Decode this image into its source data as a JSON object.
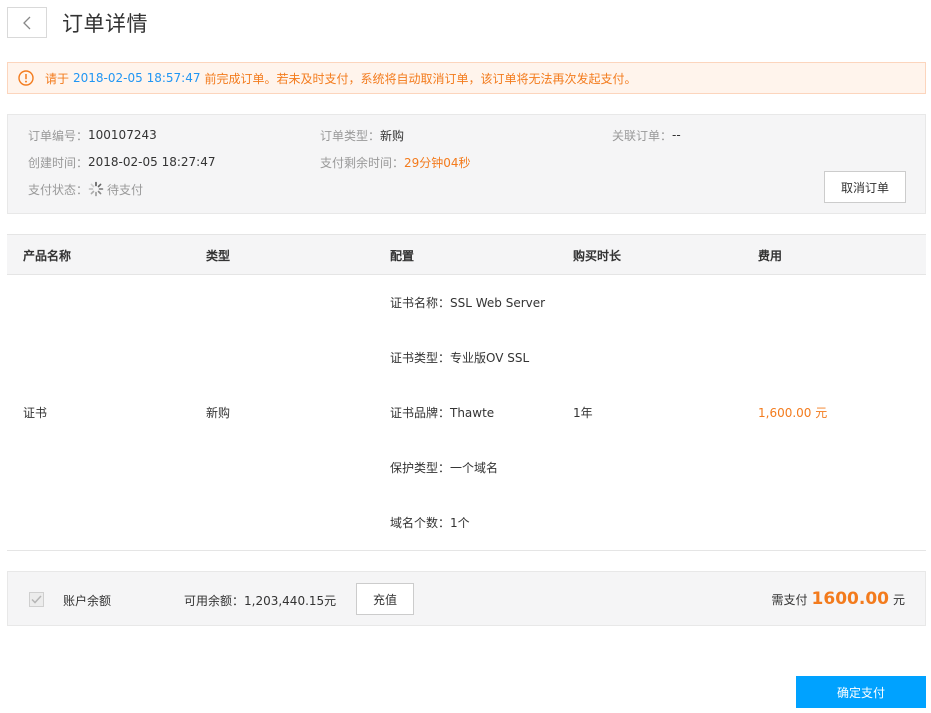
{
  "header": {
    "title": "订单详情"
  },
  "alert": {
    "prefix": "请于",
    "deadline": "2018-02-05 18:57:47",
    "suffix": "前完成订单。若未及时支付，系统将自动取消订单，该订单将无法再次发起支付。"
  },
  "order": {
    "number_label": "订单编号：",
    "number": "100107243",
    "type_label": "订单类型：",
    "type": "新购",
    "related_label": "关联订单：",
    "related": "--",
    "created_label": "创建时间：",
    "created": "2018-02-05 18:27:47",
    "remaining_label": "支付剩余时间：",
    "remaining": "29分钟04秒",
    "status_label": "支付状态：",
    "status": "待支付",
    "cancel_label": "取消订单"
  },
  "table": {
    "headers": [
      "产品名称",
      "类型",
      "配置",
      "购买时长",
      "费用"
    ],
    "row": {
      "product": "证书",
      "type": "新购",
      "config": [
        "证书名称：SSL Web Server",
        "证书类型：专业版OV SSL",
        "证书品牌：Thawte",
        "保护类型：一个域名",
        "域名个数：1个"
      ],
      "duration": "1年",
      "fee": "1,600.00 元"
    }
  },
  "payment": {
    "account_label": "账户余额",
    "balance_label": "可用余额：1,203,440.15元",
    "recharge_label": "充值",
    "need_pay_label": "需支付",
    "amount": "1600.00",
    "unit": "元",
    "confirm_label": "确定支付"
  },
  "colors": {
    "accent_orange": "#f37b1d",
    "link_blue": "#2196f3",
    "primary_button": "#00a2ff"
  }
}
